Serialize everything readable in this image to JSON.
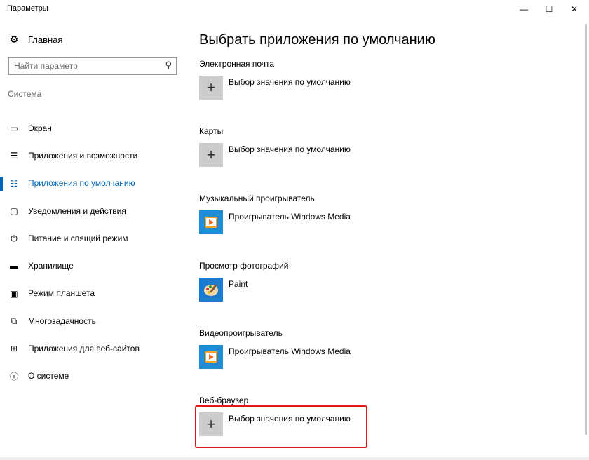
{
  "window": {
    "title": "Параметры",
    "controls": {
      "minimize": "—",
      "maximize": "☐",
      "close": "✕"
    }
  },
  "sidebar": {
    "home": {
      "label": "Главная",
      "icon": "gear-icon"
    },
    "search": {
      "placeholder": "Найти параметр",
      "value": "",
      "icon": "search-icon"
    },
    "section_label": "Система",
    "items": [
      {
        "label": "Экран",
        "icon": "display-icon",
        "glyph": "▭",
        "active": false
      },
      {
        "label": "Приложения и возможности",
        "icon": "list-icon",
        "glyph": "☰",
        "active": false
      },
      {
        "label": "Приложения по умолчанию",
        "icon": "default-apps-icon",
        "glyph": "☷",
        "active": true
      },
      {
        "label": "Уведомления и действия",
        "icon": "notification-icon",
        "glyph": "▢",
        "active": false
      },
      {
        "label": "Питание и спящий режим",
        "icon": "power-icon",
        "glyph": "⏻",
        "active": false
      },
      {
        "label": "Хранилище",
        "icon": "storage-icon",
        "glyph": "▬",
        "active": false
      },
      {
        "label": "Режим планшета",
        "icon": "tablet-icon",
        "glyph": "▣",
        "active": false
      },
      {
        "label": "Многозадачность",
        "icon": "multitask-icon",
        "glyph": "⧉",
        "active": false
      },
      {
        "label": "Приложения для веб-сайтов",
        "icon": "web-apps-icon",
        "glyph": "⊞",
        "active": false
      },
      {
        "label": "О системе",
        "icon": "info-icon",
        "glyph": "ⓘ",
        "active": false
      }
    ]
  },
  "main": {
    "title": "Выбрать приложения по умолчанию",
    "groups": [
      {
        "label": "Электронная почта",
        "app": "Выбор значения по умолчанию",
        "tile": "plus"
      },
      {
        "label": "Карты",
        "app": "Выбор значения по умолчанию",
        "tile": "plus"
      },
      {
        "label": "Музыкальный проигрыватель",
        "app": "Проигрыватель Windows Media",
        "tile": "wmp"
      },
      {
        "label": "Просмотр фотографий",
        "app": "Paint",
        "tile": "paint"
      },
      {
        "label": "Видеопроигрыватель",
        "app": "Проигрыватель Windows Media",
        "tile": "wmp"
      },
      {
        "label": "Веб-браузер",
        "app": "Выбор значения по умолчанию",
        "tile": "plus"
      }
    ]
  },
  "colors": {
    "accent": "#0063b1",
    "highlight": "#e01a1a",
    "plus_tile": "#cccccc",
    "wmp_tile": "#1f8dd6",
    "paint_tile": "#1a7bd0"
  }
}
